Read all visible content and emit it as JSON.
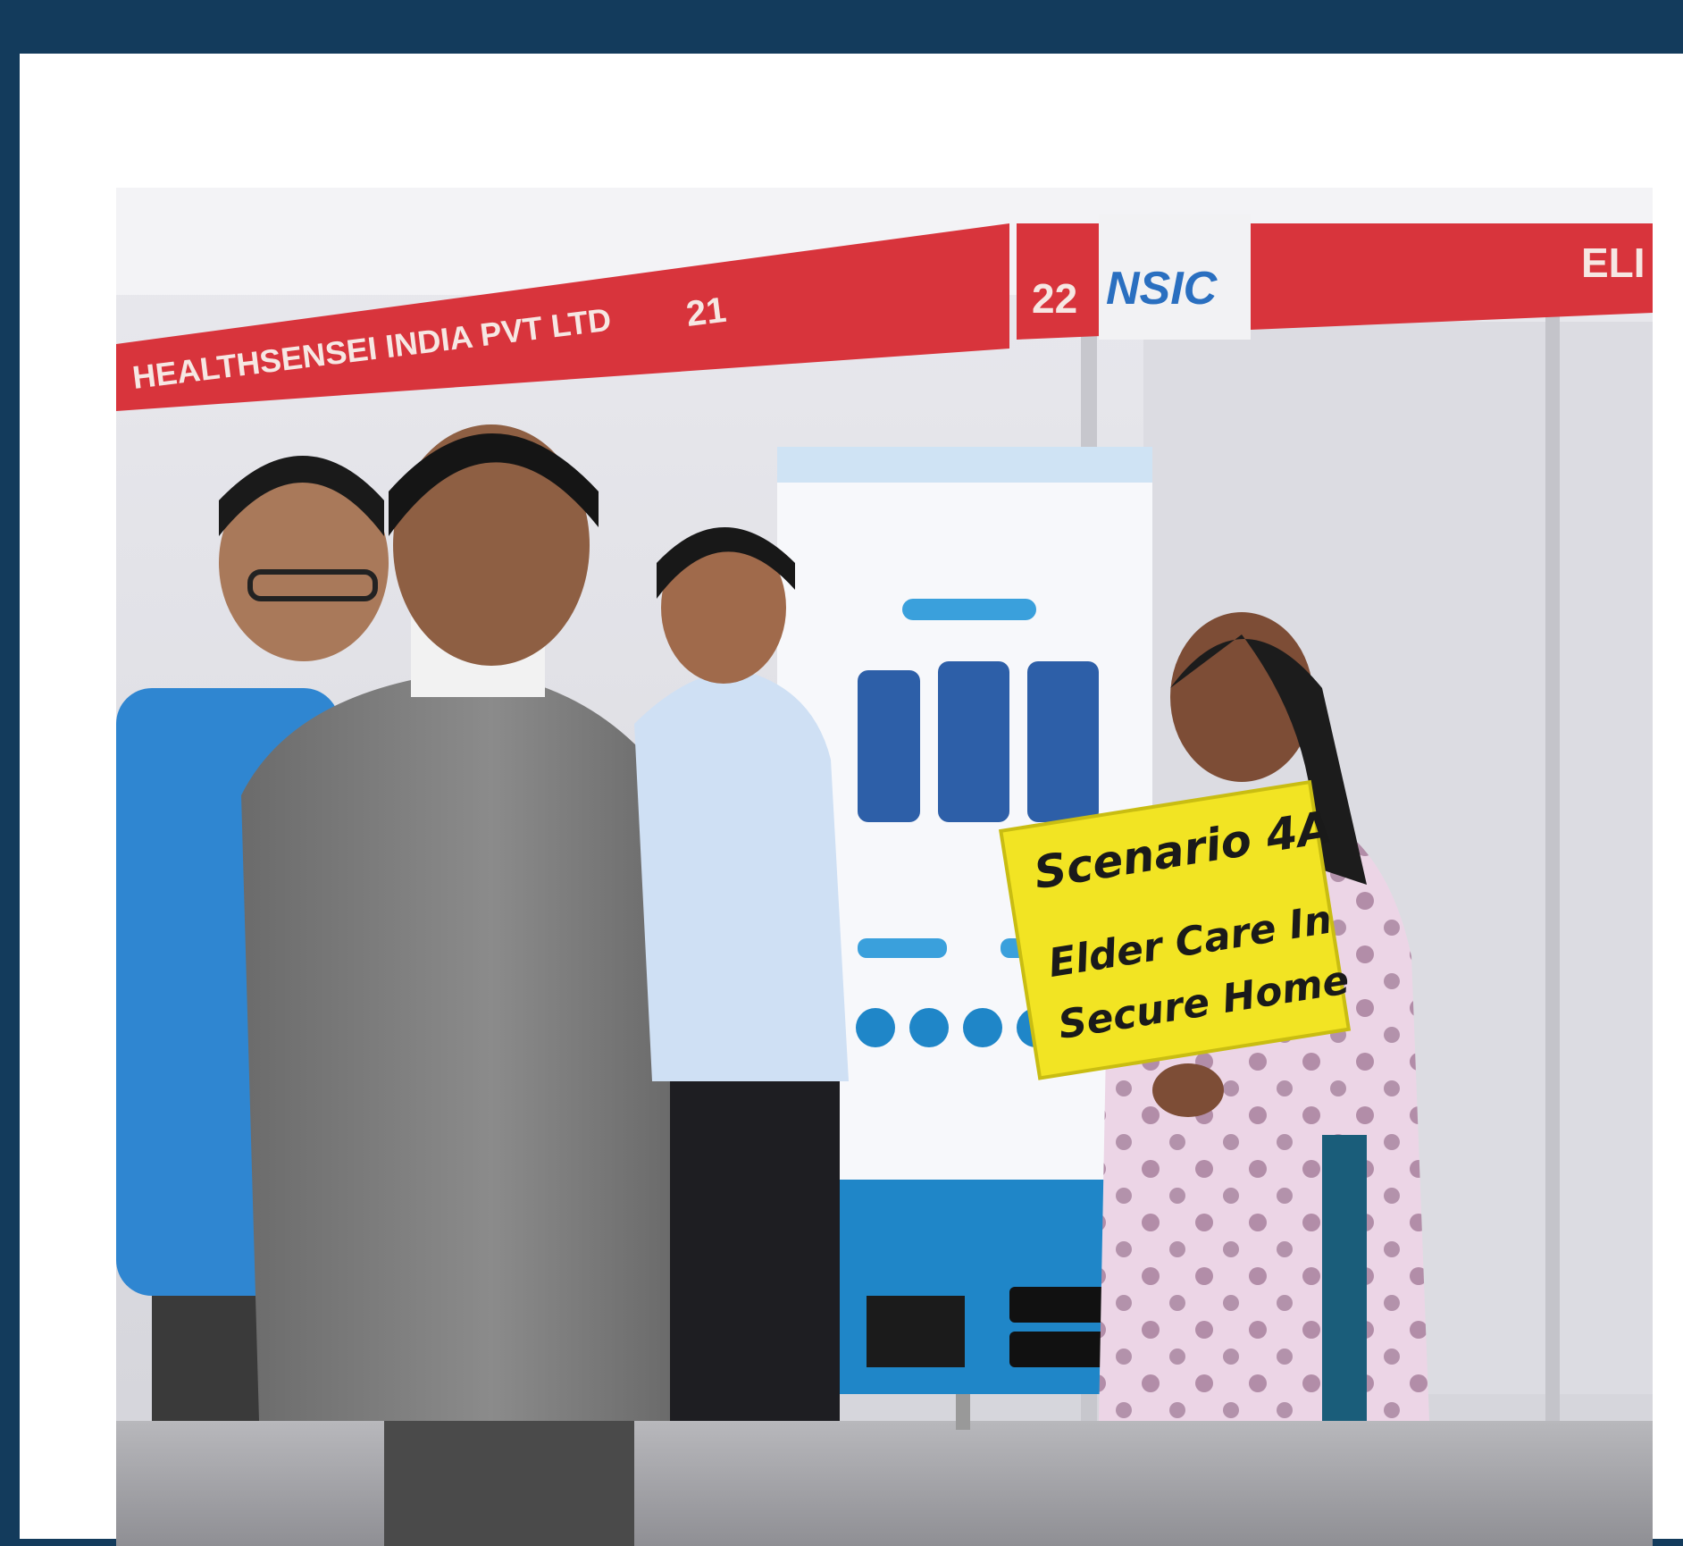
{
  "photo": {
    "booth_banner_left": "HEALTHSENSEI INDIA PVT LTD",
    "booth_number_left": "21",
    "booth_number_right": "22",
    "sponsor_logo": "NSIC",
    "banner_right_partial": "ELI",
    "placard": {
      "line1": "Scenario 4A",
      "line2": "Elder Care In",
      "line3": "Secure Home"
    },
    "colors": {
      "outer_frame": "#133b5c",
      "banner_red": "#d8343c",
      "placard_yellow": "#f2e423",
      "poster_blue": "#1f86c8"
    }
  }
}
